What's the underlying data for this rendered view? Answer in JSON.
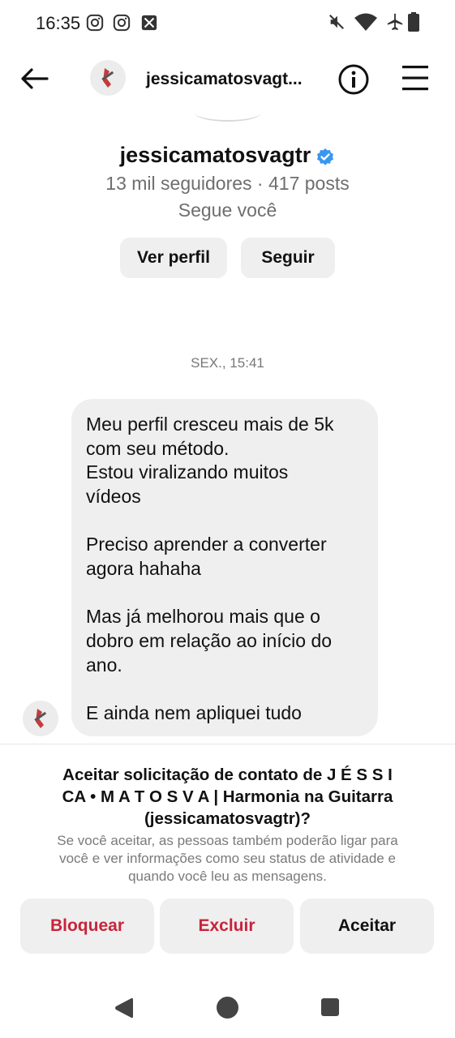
{
  "status_bar": {
    "time": "16:35",
    "left_icons": [
      "instagram-icon",
      "instagram-icon",
      "photo-x-icon"
    ],
    "right_icons": [
      "mute-icon",
      "wifi-icon",
      "airplane-icon",
      "battery-icon"
    ]
  },
  "header": {
    "username": "jessicamatosvagt...",
    "back_icon": "arrow-left-icon",
    "info_icon": "info-icon",
    "menu_icon": "menu-icon"
  },
  "profile": {
    "name": "jessicamatosvagtr",
    "verified": true,
    "stats": "13 mil seguidores · 417 posts",
    "follows_you": "Segue você",
    "view_profile_label": "Ver perfil",
    "follow_label": "Seguir"
  },
  "conversation": {
    "timestamp": "SEX., 15:41",
    "message_lines": [
      "Meu perfil cresceu mais de 5k",
      "com seu método.",
      "Estou viralizando muitos",
      "vídeos",
      "",
      "Preciso aprender a converter",
      "agora hahaha",
      "",
      "Mas já melhorou mais que o",
      "dobro em relação ao início do",
      "ano.",
      "",
      "E ainda nem apliquei tudo"
    ]
  },
  "request": {
    "title_line1": "Aceitar solicitação de contato de J É S S I",
    "title_line2": "CA • M A T O S V A | Harmonia na Guitarra",
    "title_line3": "(jessicamatosvagtr)?",
    "desc_line1": "Se você aceitar, as pessoas também poderão ligar para",
    "desc_line2": "você e ver informações como seu status de atividade e",
    "desc_line3": "quando você leu as mensagens.",
    "block_label": "Bloquear",
    "delete_label": "Excluir",
    "accept_label": "Aceitar"
  },
  "colors": {
    "danger": "#c8243b",
    "verified": "#3897f0",
    "button_bg": "#efefef",
    "muted_text": "#6e6e6e"
  },
  "nav_bar": [
    "back-triangle-icon",
    "home-circle-icon",
    "recents-square-icon"
  ]
}
